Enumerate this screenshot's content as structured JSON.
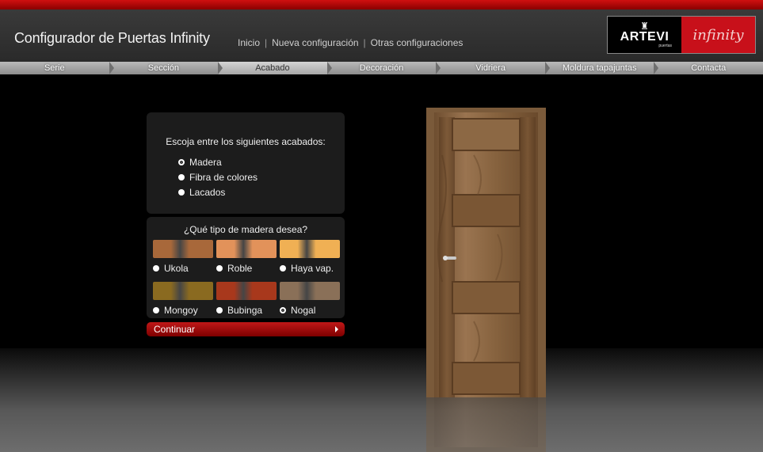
{
  "header": {
    "title": "Configurador de Puertas Infinity",
    "links": [
      {
        "label": "Inicio"
      },
      {
        "label": "Nueva configuración"
      },
      {
        "label": "Otras configuraciones"
      }
    ],
    "separator": "|",
    "logo_brand": "ARTEVI",
    "logo_sub": "puertas",
    "logo_script": "infinity"
  },
  "nav": {
    "items": [
      {
        "label": "Serie"
      },
      {
        "label": "Sección"
      },
      {
        "label": "Acabado",
        "active": true
      },
      {
        "label": "Decoración"
      },
      {
        "label": "Vidriera"
      },
      {
        "label": "Moldura tapajuntas"
      },
      {
        "label": "Contacta"
      }
    ]
  },
  "finish": {
    "prompt": "Escoja entre los siguientes acabados:",
    "options": [
      {
        "label": "Madera",
        "selected": true
      },
      {
        "label": "Fibra de colores",
        "selected": false
      },
      {
        "label": "Lacados",
        "selected": false
      }
    ]
  },
  "wood": {
    "prompt": "¿Qué tipo de madera desea?",
    "options": [
      {
        "label": "Ukola",
        "color": "#a8683a",
        "selected": false
      },
      {
        "label": "Roble",
        "color": "#e2925a",
        "selected": false
      },
      {
        "label": "Haya vap.",
        "color": "#f0b054",
        "selected": false
      },
      {
        "label": "Mongoy",
        "color": "#8a6a20",
        "selected": false
      },
      {
        "label": "Bubinga",
        "color": "#a8381c",
        "selected": false
      },
      {
        "label": "Nogal",
        "color": "#8a7058",
        "selected": true
      }
    ]
  },
  "continue_label": "Continuar",
  "colors": {
    "accent_red": "#c01818",
    "door_wood": "#8f6b45"
  }
}
